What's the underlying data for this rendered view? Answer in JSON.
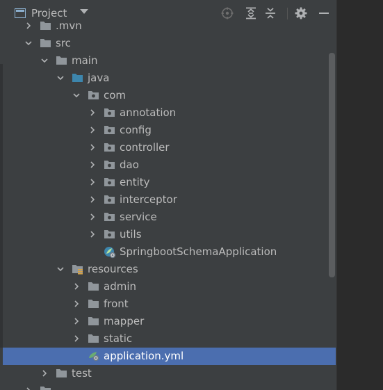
{
  "header": {
    "title": "Project",
    "buttons": [
      "locate-icon",
      "expand-all-icon",
      "collapse-all-icon",
      "gear-icon",
      "minimize-icon"
    ]
  },
  "tree": [
    {
      "label": ".mvn",
      "depth": 1,
      "expanded": false,
      "icon": "folder-icon"
    },
    {
      "label": "src",
      "depth": 1,
      "expanded": true,
      "icon": "folder-icon"
    },
    {
      "label": "main",
      "depth": 2,
      "expanded": true,
      "icon": "folder-icon"
    },
    {
      "label": "java",
      "depth": 3,
      "expanded": true,
      "icon": "source-folder-icon"
    },
    {
      "label": "com",
      "depth": 4,
      "expanded": true,
      "icon": "package-icon"
    },
    {
      "label": "annotation",
      "depth": 5,
      "expanded": false,
      "icon": "package-icon"
    },
    {
      "label": "config",
      "depth": 5,
      "expanded": false,
      "icon": "package-icon"
    },
    {
      "label": "controller",
      "depth": 5,
      "expanded": false,
      "icon": "package-icon"
    },
    {
      "label": "dao",
      "depth": 5,
      "expanded": false,
      "icon": "package-icon"
    },
    {
      "label": "entity",
      "depth": 5,
      "expanded": false,
      "icon": "package-icon"
    },
    {
      "label": "interceptor",
      "depth": 5,
      "expanded": false,
      "icon": "package-icon"
    },
    {
      "label": "service",
      "depth": 5,
      "expanded": false,
      "icon": "package-icon"
    },
    {
      "label": "utils",
      "depth": 5,
      "expanded": false,
      "icon": "package-icon"
    },
    {
      "label": "SpringbootSchemaApplication",
      "depth": 5,
      "expanded": null,
      "icon": "spring-boot-class-icon"
    },
    {
      "label": "resources",
      "depth": 3,
      "expanded": true,
      "icon": "resources-folder-icon"
    },
    {
      "label": "admin",
      "depth": 4,
      "expanded": false,
      "icon": "folder-icon"
    },
    {
      "label": "front",
      "depth": 4,
      "expanded": false,
      "icon": "folder-icon"
    },
    {
      "label": "mapper",
      "depth": 4,
      "expanded": false,
      "icon": "folder-icon"
    },
    {
      "label": "static",
      "depth": 4,
      "expanded": false,
      "icon": "folder-icon"
    },
    {
      "label": "application.yml",
      "depth": 4,
      "expanded": null,
      "icon": "spring-yml-icon",
      "selected": true
    },
    {
      "label": "test",
      "depth": 2,
      "expanded": false,
      "icon": "folder-icon"
    },
    {
      "label": "",
      "depth": 1,
      "expanded": false,
      "icon": "folder-icon"
    }
  ],
  "colors": {
    "panel_bg": "#3c3f41",
    "editor_bg": "#2b2b2b",
    "selection": "#4b6eaf",
    "text": "#bbbbbb",
    "folder": "#90969b",
    "source_folder": "#3d86ad",
    "spring": "#6aab73"
  }
}
